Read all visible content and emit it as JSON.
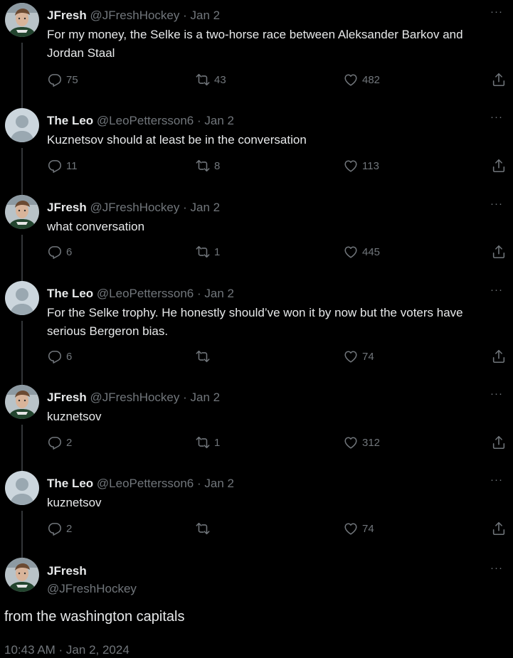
{
  "tweets": [
    {
      "name": "JFresh",
      "handle": "@JFreshHockey",
      "date": "Jan 2",
      "text": "For my money, the Selke is a two-horse race between Aleksander Barkov and Jordan Staal",
      "replies": "75",
      "retweets": "43",
      "likes": "482",
      "avatar": "photo"
    },
    {
      "name": "The Leo",
      "handle": "@LeoPettersson6",
      "date": "Jan 2",
      "text": "Kuznetsov should at least be in the conversation",
      "replies": "11",
      "retweets": "8",
      "likes": "113",
      "avatar": "default"
    },
    {
      "name": "JFresh",
      "handle": "@JFreshHockey",
      "date": "Jan 2",
      "text": "what conversation",
      "replies": "6",
      "retweets": "1",
      "likes": "445",
      "avatar": "photo"
    },
    {
      "name": "The Leo",
      "handle": "@LeoPettersson6",
      "date": "Jan 2",
      "text": "For the Selke trophy. He honestly should’ve won it by now but the voters have serious Bergeron bias.",
      "replies": "6",
      "retweets": "",
      "likes": "74",
      "avatar": "default"
    },
    {
      "name": "JFresh",
      "handle": "@JFreshHockey",
      "date": "Jan 2",
      "text": "kuznetsov",
      "replies": "2",
      "retweets": "1",
      "likes": "312",
      "avatar": "photo"
    },
    {
      "name": "The Leo",
      "handle": "@LeoPettersson6",
      "date": "Jan 2",
      "text": "kuznetsov",
      "replies": "2",
      "retweets": "",
      "likes": "74",
      "avatar": "default"
    }
  ],
  "main_tweet": {
    "name": "JFresh",
    "handle": "@JFreshHockey",
    "text": "from the washington capitals",
    "timestamp": "10:43 AM · Jan 2, 2024"
  },
  "more_label": "···",
  "separator": " · ",
  "colors": {
    "background": "#000000",
    "text": "#e7e9ea",
    "muted": "#71767b",
    "line": "#333639"
  },
  "icons": [
    "reply-icon",
    "retweet-icon",
    "like-icon",
    "share-icon",
    "more-icon"
  ]
}
